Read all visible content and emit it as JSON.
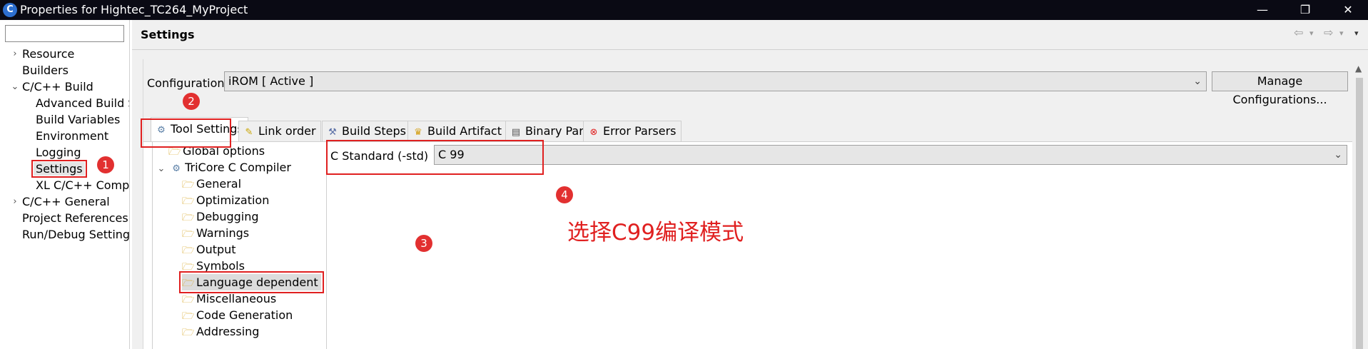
{
  "window": {
    "title": "Properties for Hightec_TC264_MyProject",
    "controls": {
      "minimize": "—",
      "restore": "❐",
      "close": "✕"
    }
  },
  "sidebar": {
    "filter_placeholder": "",
    "items": [
      {
        "label": "Resource",
        "twisty": "›"
      },
      {
        "label": "Builders",
        "twisty": ""
      },
      {
        "label": "C/C++ Build",
        "twisty": "⌄"
      },
      {
        "label": "Advanced Build S"
      },
      {
        "label": "Build Variables"
      },
      {
        "label": "Environment"
      },
      {
        "label": "Logging"
      },
      {
        "label": "Settings"
      },
      {
        "label": "XL C/C++ Compi"
      },
      {
        "label": "C/C++ General",
        "twisty": "›"
      },
      {
        "label": "Project References"
      },
      {
        "label": "Run/Debug Settings"
      }
    ]
  },
  "header": {
    "title": "Settings",
    "nav": {
      "back": "⇦",
      "forward": "⇨",
      "menu": "▾"
    }
  },
  "configuration": {
    "label": "Configuration:",
    "value": "iROM  [ Active ]",
    "manage_label": "Manage Configurations..."
  },
  "tabs": [
    {
      "label": "Tool Settings"
    },
    {
      "label": "Link order"
    },
    {
      "label": "Build Steps"
    },
    {
      "label": "Build Artifact"
    },
    {
      "label": "Binary Parsers"
    },
    {
      "label": "Error Parsers"
    }
  ],
  "tool_tree": [
    {
      "label": "Global options"
    },
    {
      "label": "TriCore C Compiler",
      "twisty": "⌄"
    },
    {
      "label": "General"
    },
    {
      "label": "Optimization"
    },
    {
      "label": "Debugging"
    },
    {
      "label": "Warnings"
    },
    {
      "label": "Output"
    },
    {
      "label": "Symbols"
    },
    {
      "label": "Language dependent"
    },
    {
      "label": "Miscellaneous"
    },
    {
      "label": "Code Generation"
    },
    {
      "label": "Addressing"
    }
  ],
  "option": {
    "label": "C Standard (-std)",
    "value": "C 99"
  },
  "badges": [
    "1",
    "2",
    "3",
    "4"
  ],
  "annotation": "选择C99编译模式",
  "colors": {
    "highlight": "#e02020",
    "titlebar": "#0a0a14",
    "folder": "#d4a017"
  },
  "icons": {
    "app": "eclipse-icon",
    "folder": "folder-icon",
    "gear": "gear-icon"
  }
}
